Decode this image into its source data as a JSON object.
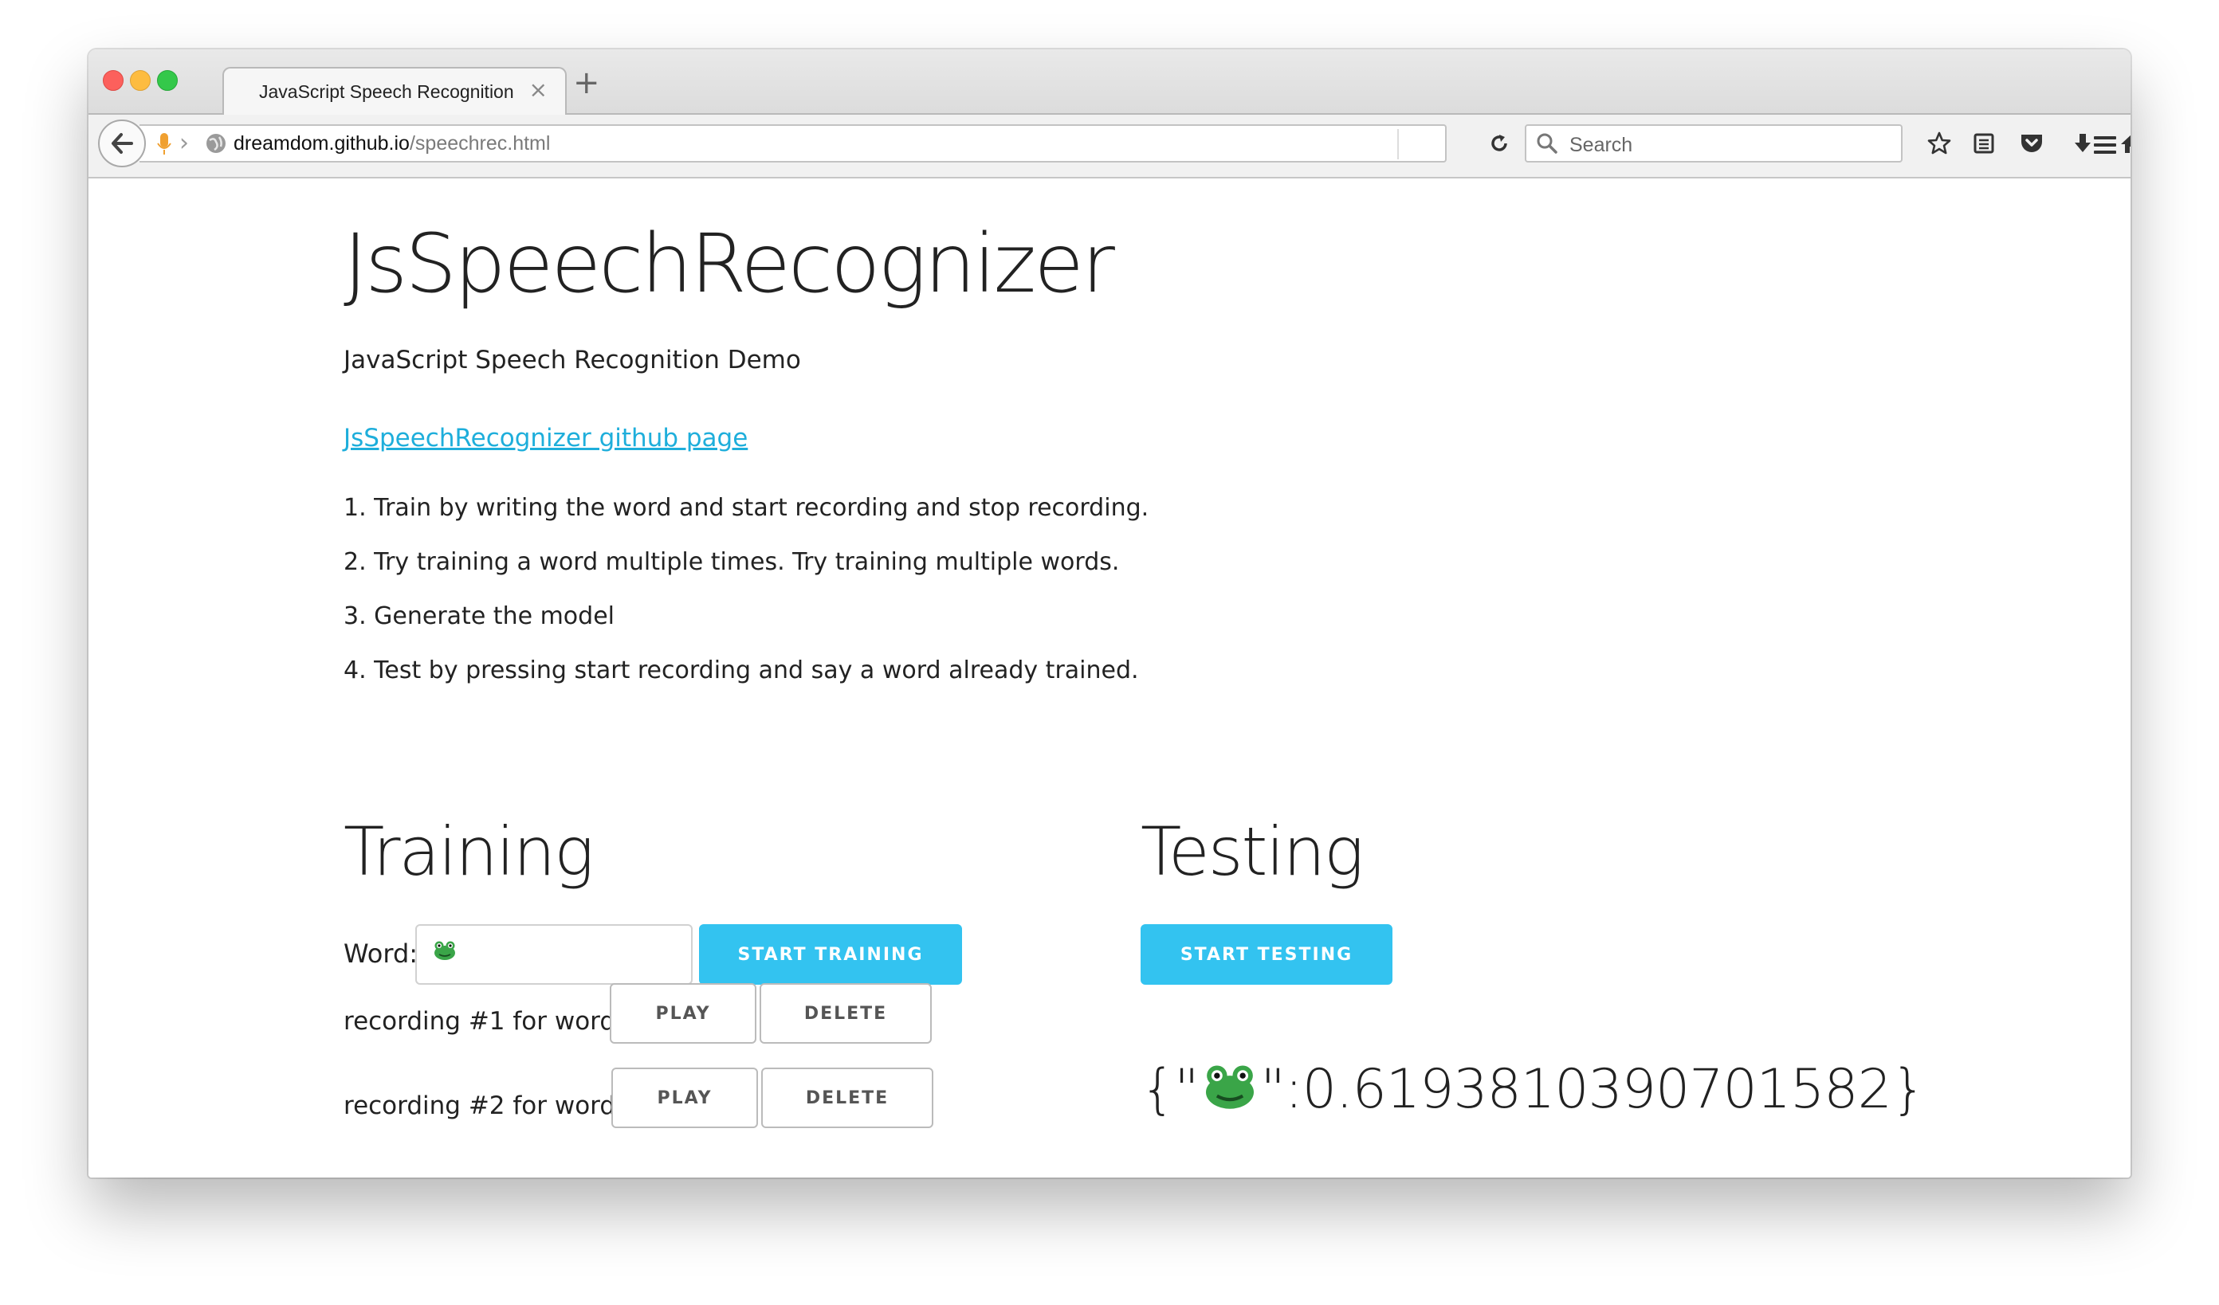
{
  "browser": {
    "tab_title": "JavaScript Speech Recognition",
    "tab_close": "×",
    "new_tab": "+",
    "url_domain": "dreamdom.github.io",
    "url_path": "/speechrec.html",
    "search_placeholder": "Search",
    "toolbar_icons": [
      "star-icon",
      "reading-list-icon",
      "pocket-icon",
      "download-icon",
      "home-icon",
      "hello-icon",
      "menu-icon"
    ]
  },
  "page": {
    "title": "JsSpeechRecognizer",
    "subtitle": "JavaScript Speech Recognition Demo",
    "github_link": "JsSpeechRecognizer github page",
    "steps": [
      "1. Train by writing the word and start recording and stop recording.",
      "2. Try training a word multiple times. Try training multiple words.",
      "3. Generate the model",
      "4. Test by pressing start recording and say a word already trained."
    ]
  },
  "training": {
    "heading": "Training",
    "word_label": "Word:",
    "start_button": "START TRAINING",
    "recordings": [
      {
        "label": "recording #1 for word",
        "icon": "rooster-emoji",
        "play": "PLAY",
        "delete": "DELETE"
      },
      {
        "label": "recording #2 for word",
        "icon": "frog-emoji",
        "play": "PLAY",
        "delete": "DELETE"
      }
    ]
  },
  "testing": {
    "heading": "Testing",
    "start_button": "START TESTING",
    "result_prefix": "{\"",
    "result_suffix": "\":0.6193810390701582}"
  },
  "colors": {
    "accent": "#33c3f0",
    "link": "#1eaedb",
    "text": "#222222"
  }
}
